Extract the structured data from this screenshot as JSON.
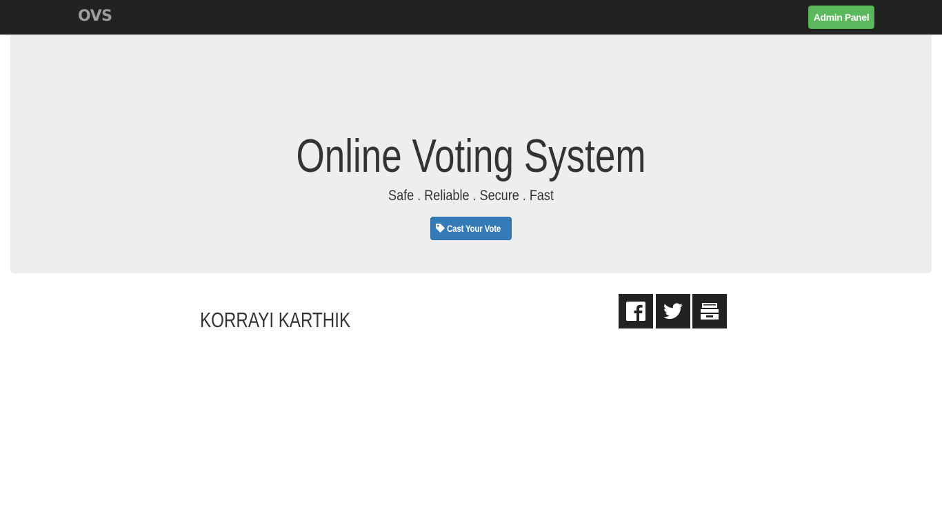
{
  "navbar": {
    "brand": "OVS",
    "admin_button": "Admin Panel"
  },
  "hero": {
    "title": "Online Voting System",
    "tagline": "Safe . Reliable . Secure . Fast",
    "cta_label": "Cast Your Vote",
    "cta_icon": "tag-icon"
  },
  "footer": {
    "author": "KORRAYI KARTHIK",
    "social": [
      {
        "name": "facebook-icon"
      },
      {
        "name": "twitter-icon"
      },
      {
        "name": "archive-icon"
      }
    ]
  },
  "colors": {
    "navbar_bg": "#222222",
    "admin_button_bg": "#5cb85c",
    "cta_bg": "#337ab7",
    "jumbotron_bg": "#eeeeee",
    "social_bg": "#222222"
  }
}
